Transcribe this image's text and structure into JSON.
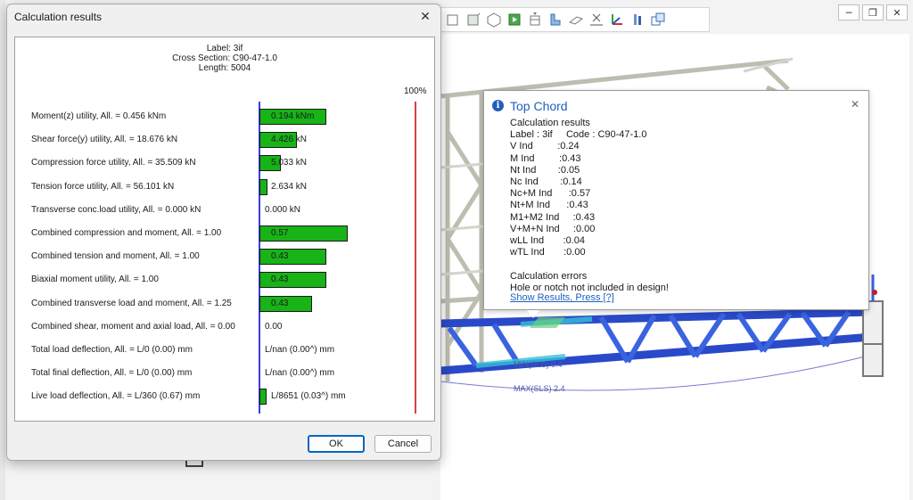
{
  "dialog": {
    "title": "Calculation results",
    "header": {
      "label": "Label: 3if",
      "cross_section": "Cross Section: C90-47-1.0",
      "length": "Length: 5004"
    },
    "scale_label": "100%",
    "rows": [
      {
        "label": "Moment(z) utility, All. = 0.456 kNm",
        "value": "0.194 kNm",
        "fraction": 0.43
      },
      {
        "label": "Shear force(y) utility, All. = 18.676 kN",
        "value": "4.426 kN",
        "fraction": 0.24
      },
      {
        "label": "Compression force utility, All. = 35.509 kN",
        "value": "5.033 kN",
        "fraction": 0.14
      },
      {
        "label": "Tension force utility, All. = 56.101 kN",
        "value": "2.634 kN",
        "fraction": 0.05
      },
      {
        "label": "Transverse conc.load utility, All. = 0.000 kN",
        "value": "0.000 kN",
        "fraction": 0
      },
      {
        "label": "Combined compression and moment, All. = 1.00",
        "value": "0.57",
        "fraction": 0.57
      },
      {
        "label": "Combined tension and moment, All. = 1.00",
        "value": "0.43",
        "fraction": 0.43
      },
      {
        "label": "Biaxial moment utility, All. = 1.00",
        "value": "0.43",
        "fraction": 0.43
      },
      {
        "label": "Combined transverse load and moment, All. = 1.25",
        "value": "0.43",
        "fraction": 0.34
      },
      {
        "label": "Combined shear, moment and axial load, All. = 0.00",
        "value": "0.00",
        "fraction": 0
      },
      {
        "label": "Total load deflection, All. = L/0 (0.00) mm",
        "value": "L/nan (0.00^) mm",
        "fraction": 0
      },
      {
        "label": "Total final deflection, All. = L/0 (0.00) mm",
        "value": "L/nan (0.00^) mm",
        "fraction": 0
      },
      {
        "label": "Live load deflection, All. = L/360 (0.67) mm",
        "value": "L/8651 (0.03^) mm",
        "fraction": 0.04
      }
    ],
    "ok_label": "OK",
    "cancel_label": "Cancel"
  },
  "tooltip": {
    "title": "Top Chord",
    "lines": [
      "Calculation results",
      "Label : 3if     Code : C90-47-1.0",
      "V Ind         :0.24",
      "M Ind         :0.43",
      "Nt Ind        :0.05",
      "Nc Ind        :0.14",
      "Nc+M Ind      :0.57",
      "Nt+M Ind      :0.43",
      "M1+M2 Ind     :0.43",
      "V+M+N Ind     :0.00",
      "wLL Ind       :0.04",
      "wTL Ind       :0.00",
      "",
      "Calculation errors",
      "Hole or notch not included in design!"
    ],
    "link": "Show Results, Press [?]"
  },
  "viewport": {
    "min_label": "MIN(SLS) 0.4",
    "max_label": "MAX(SLS) 2.4"
  },
  "colors": {
    "bar_fill": "#17b317",
    "zero_axis": "#3b3bdf",
    "limit_axis": "#d94040",
    "tooltip_title": "#1f5fbf",
    "truss_blue": "#2a49c8"
  }
}
